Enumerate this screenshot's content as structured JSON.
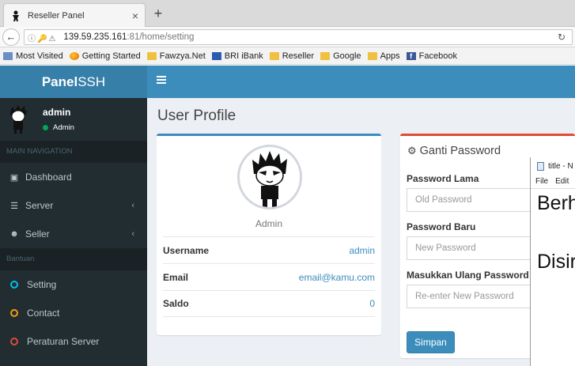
{
  "browser": {
    "tab_title": "Reseller Panel",
    "tab_close": "×",
    "new_tab": "+",
    "url_host": "139.59.235.161",
    "url_path": ":81/home/setting",
    "bookmarks": [
      "Most Visited",
      "Getting Started",
      "Fawzya.Net",
      "BRI iBank",
      "Reseller",
      "Google",
      "Apps",
      "Facebook"
    ]
  },
  "header": {
    "logo_bold": "Panel",
    "logo_rest": "SSH"
  },
  "sidebar": {
    "user_name": "admin",
    "user_status": "Admin",
    "main_nav_header": "MAIN NAVIGATION",
    "items": [
      {
        "label": "Dashboard",
        "icon": "dashboard-icon"
      },
      {
        "label": "Server",
        "icon": "server-icon"
      },
      {
        "label": "Seller",
        "icon": "users-icon"
      }
    ],
    "help_header": "Bantuan",
    "help_items": [
      {
        "label": "Setting",
        "color": "#00c0ef"
      },
      {
        "label": "Contact",
        "color": "#f39c12"
      },
      {
        "label": "Peraturan Server",
        "color": "#dd4b39"
      }
    ]
  },
  "page": {
    "title": "User Profile"
  },
  "profile": {
    "name": "Admin",
    "rows": [
      {
        "key": "Username",
        "value": "admin"
      },
      {
        "key": "Email",
        "value": "email@kamu.com"
      },
      {
        "key": "Saldo",
        "value": "0"
      }
    ]
  },
  "password": {
    "title": "Ganti Password",
    "old_label": "Password Lama",
    "old_placeholder": "Old Password",
    "new_label": "Password Baru",
    "new_placeholder": "New Password",
    "confirm_label": "Masukkan Ulang Password",
    "confirm_placeholder": "Re-enter New Password",
    "submit": "Simpan"
  },
  "notepad": {
    "title": "title - N",
    "menu_file": "File",
    "menu_edit": "Edit",
    "line1": "Berh",
    "line2": "Disir"
  }
}
